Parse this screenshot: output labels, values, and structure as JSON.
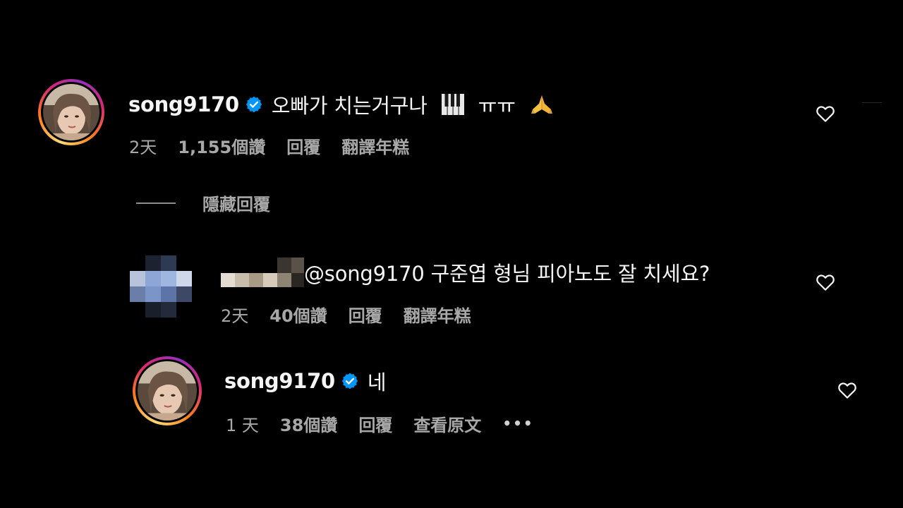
{
  "colors": {
    "background": "#000000",
    "text_primary": "#f5f5f5",
    "text_secondary": "#a8a8a8",
    "verified_badge": "#0095f6"
  },
  "comment_main": {
    "username": "song9170",
    "verified": true,
    "text": "오빠가 치는거구나",
    "emoji_piano": "piano-keys-icon",
    "text_suffix": "ㅠㅠ",
    "emoji_pray": "folded-hands-icon",
    "time": "2天",
    "likes": "1,155個讚",
    "reply": "回覆",
    "translate": "翻譯年糕"
  },
  "hide_replies": {
    "label": "隱藏回覆"
  },
  "reply_1": {
    "username_hidden": true,
    "text": "@song9170 구준엽 형님 피아노도 잘 치세요?",
    "time": "2天",
    "likes": "40個讚",
    "reply": "回覆",
    "translate": "翻譯年糕"
  },
  "reply_2": {
    "username": "song9170",
    "verified": true,
    "text": "네",
    "time": "1 天",
    "likes": "38個讚",
    "reply": "回覆",
    "see_original": "查看原文",
    "more": "•••"
  }
}
